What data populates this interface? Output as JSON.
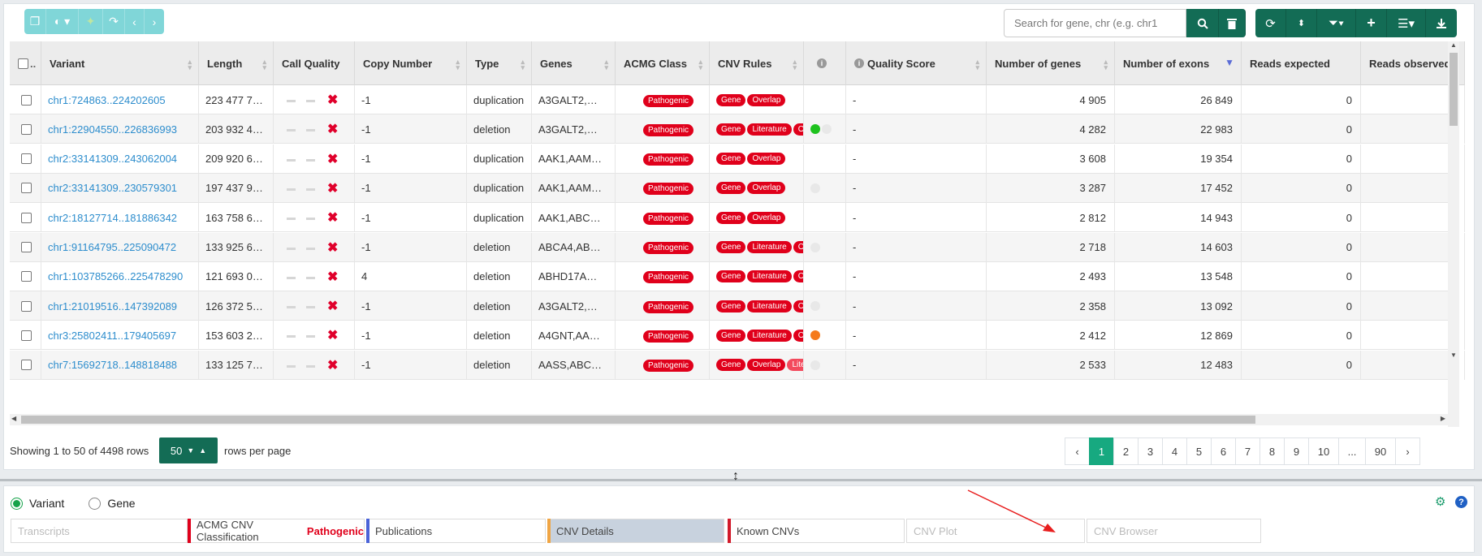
{
  "toolbar": {
    "search_placeholder": "Search for gene, chr (e.g. chr1",
    "left_buttons": [
      "copy-icon",
      "contrast-icon",
      "magic-icon",
      "share-icon",
      "chevron-left-icon",
      "chevron-right-icon"
    ],
    "right_buttons": [
      "refresh-icon",
      "sort-icon",
      "filter-icon",
      "plus-icon",
      "columns-icon",
      "download-icon"
    ]
  },
  "columns": [
    "",
    "Variant",
    "Length",
    "Call Quality",
    "Copy Number",
    "Type",
    "Genes",
    "ACMG Class",
    "CNV Rules",
    "",
    "Quality Score",
    "Number of genes",
    "Number of exons",
    "Reads expected",
    "Reads observed"
  ],
  "rows": [
    {
      "variant": "chr1:724863..224202605",
      "length": "223 477 7…",
      "copy": "-1",
      "type": "duplication",
      "genes": "A3GALT2,…",
      "acmg": "Pathogenic",
      "rules": [
        "Gene",
        "Overlap"
      ],
      "dot": "",
      "quality": "-",
      "ngenes": "4 905",
      "nexons": "26 849",
      "reads_expected": "0"
    },
    {
      "variant": "chr1:22904550..226836993",
      "length": "203 932 4…",
      "copy": "-1",
      "type": "deletion",
      "genes": "A3GALT2,…",
      "acmg": "Pathogenic",
      "rules": [
        "Gene",
        "Literature",
        "Ove"
      ],
      "dot": "green",
      "quality": "-",
      "ngenes": "4 282",
      "nexons": "22 983",
      "reads_expected": "0"
    },
    {
      "variant": "chr2:33141309..243062004",
      "length": "209 920 6…",
      "copy": "-1",
      "type": "duplication",
      "genes": "AAK1,AAM…",
      "acmg": "Pathogenic",
      "rules": [
        "Gene",
        "Overlap"
      ],
      "dot": "",
      "quality": "-",
      "ngenes": "3 608",
      "nexons": "19 354",
      "reads_expected": "0"
    },
    {
      "variant": "chr2:33141309..230579301",
      "length": "197 437 9…",
      "copy": "-1",
      "type": "duplication",
      "genes": "AAK1,AAM…",
      "acmg": "Pathogenic",
      "rules": [
        "Gene",
        "Overlap"
      ],
      "dot": "grey",
      "quality": "-",
      "ngenes": "3 287",
      "nexons": "17 452",
      "reads_expected": "0"
    },
    {
      "variant": "chr2:18127714..181886342",
      "length": "163 758 6…",
      "copy": "-1",
      "type": "duplication",
      "genes": "AAK1,ABC…",
      "acmg": "Pathogenic",
      "rules": [
        "Gene",
        "Overlap"
      ],
      "dot": "",
      "quality": "-",
      "ngenes": "2 812",
      "nexons": "14 943",
      "reads_expected": "0"
    },
    {
      "variant": "chr1:91164795..225090472",
      "length": "133 925 6…",
      "copy": "-1",
      "type": "deletion",
      "genes": "ABCA4,AB…",
      "acmg": "Pathogenic",
      "rules": [
        "Gene",
        "Literature",
        "Ove"
      ],
      "dot": "grey",
      "quality": "-",
      "ngenes": "2 718",
      "nexons": "14 603",
      "reads_expected": "0"
    },
    {
      "variant": "chr1:103785266..225478290",
      "length": "121 693 0…",
      "copy": "4",
      "type": "deletion",
      "genes": "ABHD17A…",
      "acmg": "Pathogenic",
      "rules": [
        "Gene",
        "Literature",
        "Ove"
      ],
      "dot": "",
      "quality": "-",
      "ngenes": "2 493",
      "nexons": "13 548",
      "reads_expected": "0"
    },
    {
      "variant": "chr1:21019516..147392089",
      "length": "126 372 5…",
      "copy": "-1",
      "type": "deletion",
      "genes": "A3GALT2,…",
      "acmg": "Pathogenic",
      "rules": [
        "Gene",
        "Literature",
        "Ove"
      ],
      "dot": "grey",
      "quality": "-",
      "ngenes": "2 358",
      "nexons": "13 092",
      "reads_expected": "0"
    },
    {
      "variant": "chr3:25802411..179405697",
      "length": "153 603 2…",
      "copy": "-1",
      "type": "deletion",
      "genes": "A4GNT,AA…",
      "acmg": "Pathogenic",
      "rules": [
        "Gene",
        "Literature",
        "Ove"
      ],
      "dot": "orange",
      "quality": "-",
      "ngenes": "2 412",
      "nexons": "12 869",
      "reads_expected": "0"
    },
    {
      "variant": "chr7:15692718..148818488",
      "length": "133 125 7…",
      "copy": "-1",
      "type": "deletion",
      "genes": "AASS,ABC…",
      "acmg": "Pathogenic",
      "rules": [
        "Gene",
        "Overlap",
        "Litera"
      ],
      "dot": "grey",
      "quality": "-",
      "ngenes": "2 533",
      "nexons": "12 483",
      "reads_expected": "0"
    }
  ],
  "footer": {
    "showing": "Showing 1 to 50 of 4498 rows",
    "page_size": "50",
    "per_page": "rows per page",
    "pages": [
      "‹",
      "1",
      "2",
      "3",
      "4",
      "5",
      "6",
      "7",
      "8",
      "9",
      "10",
      "...",
      "90",
      "›"
    ],
    "active_page": "1"
  },
  "bottom": {
    "radio_variant": "Variant",
    "radio_gene": "Gene",
    "tabs": [
      {
        "label": "Transcripts",
        "value": "",
        "disabled": true,
        "bar": ""
      },
      {
        "label": "ACMG CNV Classification",
        "value": "Pathogenic",
        "disabled": false,
        "bar": "#e0001b"
      },
      {
        "label": "Publications",
        "value": "",
        "disabled": false,
        "bar": "#4a63d8"
      },
      {
        "label": "CNV Details",
        "value": "",
        "disabled": false,
        "bar": "#f0a544",
        "selected": true
      },
      {
        "label": "Known CNVs",
        "value": "",
        "disabled": false,
        "bar": "#d21a2a"
      },
      {
        "label": "CNV Plot",
        "value": "",
        "disabled": true,
        "bar": ""
      },
      {
        "label": "CNV Browser",
        "value": "",
        "disabled": true,
        "bar": ""
      }
    ]
  },
  "colors": {
    "accent": "#136c55",
    "link": "#2d8dcd",
    "pathogenic": "#e0001b",
    "pager_active": "#17a980"
  }
}
